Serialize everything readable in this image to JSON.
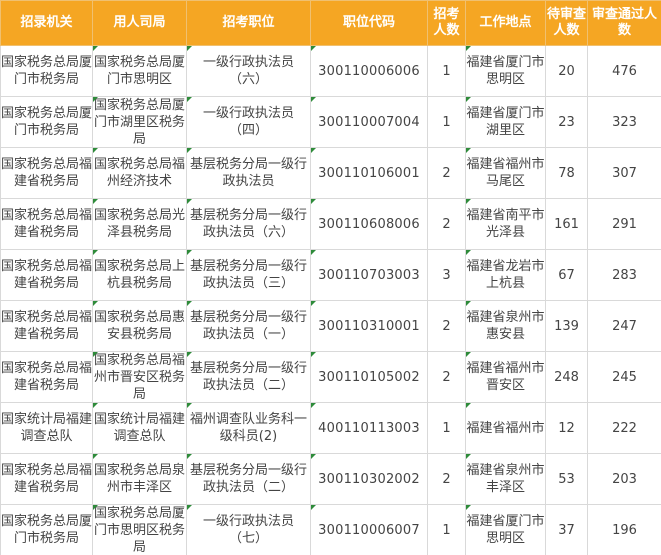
{
  "headers": {
    "h1": "招录机关",
    "h2": "用人司局",
    "h3": "招考职位",
    "h4": "职位代码",
    "h5": "招考人数",
    "h6": "工作地点",
    "h7": "待审查人数",
    "h8": "审查通过人数"
  },
  "rows": [
    {
      "org": "国家税务总局厦门市税务局",
      "dept": "国家税务总局厦门市思明区",
      "post": "一级行政执法员（六）",
      "code": "300110006006",
      "num": "1",
      "loc": "福建省厦门市思明区",
      "pending": "20",
      "passed": "476"
    },
    {
      "org": "国家税务总局厦门市税务局",
      "dept": "国家税务总局厦门市湖里区税务局",
      "post": "一级行政执法员（四）",
      "code": "300110007004",
      "num": "1",
      "loc": "福建省厦门市湖里区",
      "pending": "23",
      "passed": "323"
    },
    {
      "org": "国家税务总局福建省税务局",
      "dept": "国家税务总局福州经济技术",
      "post": "基层税务分局一级行政执法员",
      "code": "300110106001",
      "num": "2",
      "loc": "福建省福州市马尾区",
      "pending": "78",
      "passed": "307"
    },
    {
      "org": "国家税务总局福建省税务局",
      "dept": "国家税务总局光泽县税务局",
      "post": "基层税务分局一级行政执法员（六）",
      "code": "300110608006",
      "num": "2",
      "loc": "福建省南平市光泽县",
      "pending": "161",
      "passed": "291"
    },
    {
      "org": "国家税务总局福建省税务局",
      "dept": "国家税务总局上杭县税务局",
      "post": "基层税务分局一级行政执法员（三）",
      "code": "300110703003",
      "num": "3",
      "loc": "福建省龙岩市上杭县",
      "pending": "67",
      "passed": "283"
    },
    {
      "org": "国家税务总局福建省税务局",
      "dept": "国家税务总局惠安县税务局",
      "post": "基层税务分局一级行政执法员（一）",
      "code": "300110310001",
      "num": "2",
      "loc": "福建省泉州市惠安县",
      "pending": "139",
      "passed": "247"
    },
    {
      "org": "国家税务总局福建省税务局",
      "dept": "国家税务总局福州市晋安区税务局",
      "post": "基层税务分局一级行政执法员（二）",
      "code": "300110105002",
      "num": "2",
      "loc": "福建省福州市晋安区",
      "pending": "248",
      "passed": "245"
    },
    {
      "org": "国家统计局福建调查总队",
      "dept": "国家统计局福建调查总队",
      "post": "福州调查队业务科一级科员(2)",
      "code": "400110113003",
      "num": "1",
      "loc": "福建省福州市",
      "pending": "12",
      "passed": "222"
    },
    {
      "org": "国家税务总局福建省税务局",
      "dept": "国家税务总局泉州市丰泽区",
      "post": "基层税务分局一级行政执法员（二）",
      "code": "300110302002",
      "num": "2",
      "loc": "福建省泉州市丰泽区",
      "pending": "53",
      "passed": "203"
    },
    {
      "org": "国家税务总局厦门市税务局",
      "dept": "国家税务总局厦门市思明区税务局",
      "post": "一级行政执法员（七）",
      "code": "300110006007",
      "num": "1",
      "loc": "福建省厦门市思明区",
      "pending": "37",
      "passed": "196"
    }
  ]
}
